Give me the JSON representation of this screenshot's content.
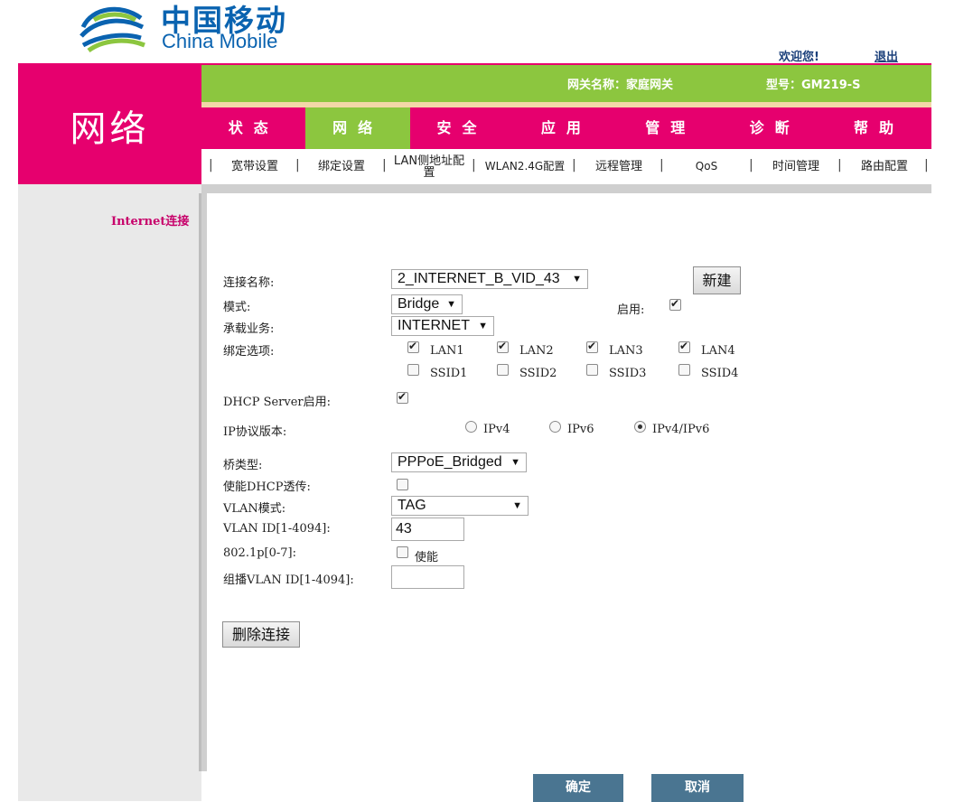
{
  "header": {
    "logo_cn": "中国移动",
    "logo_en": "China Mobile",
    "welcome": "欢迎您!",
    "logout": "退出",
    "gateway_name": "网关名称：家庭网关",
    "model": "型号：GM219-S"
  },
  "section_title": "网络",
  "main_tabs": [
    "状态",
    "网络",
    "安全",
    "应用",
    "管理",
    "诊断",
    "帮助"
  ],
  "sub_nav": [
    "宽带设置",
    "绑定设置",
    "LAN侧地址配置",
    "WLAN2.4G配置",
    "远程管理",
    "QoS",
    "时间管理",
    "路由配置"
  ],
  "sidebar": {
    "link": "Internet连接"
  },
  "form": {
    "conn_name_label": "连接名称:",
    "conn_name_value": "2_INTERNET_B_VID_43",
    "new_button": "新建",
    "mode_label": "模式:",
    "mode_value": "Bridge",
    "enable_label": "启用:",
    "service_label": "承载业务:",
    "service_value": "INTERNET",
    "bind_label": "绑定选项:",
    "bind_options": [
      "LAN1",
      "LAN2",
      "LAN3",
      "LAN4",
      "SSID1",
      "SSID2",
      "SSID3",
      "SSID4"
    ],
    "dhcp_label": "DHCP Server启用:",
    "ip_label": "IP协议版本:",
    "ip_options": [
      "IPv4",
      "IPv6",
      "IPv4/IPv6"
    ],
    "bridge_type_label": "桥类型:",
    "bridge_type_value": "PPPoE_Bridged",
    "dhcp_pass_label": "使能DHCP透传:",
    "vlan_mode_label": "VLAN模式:",
    "vlan_mode_value": "TAG",
    "vlan_id_label": "VLAN ID[1-4094]:",
    "vlan_id_value": "43",
    "p8021_label": "802.1p[0-7]:",
    "p8021_enable": "使能",
    "mcast_label": "组播VLAN ID[1-4094]:",
    "mcast_value": "",
    "delete_button": "删除连接"
  },
  "footer": {
    "ok": "确定",
    "cancel": "取消"
  }
}
